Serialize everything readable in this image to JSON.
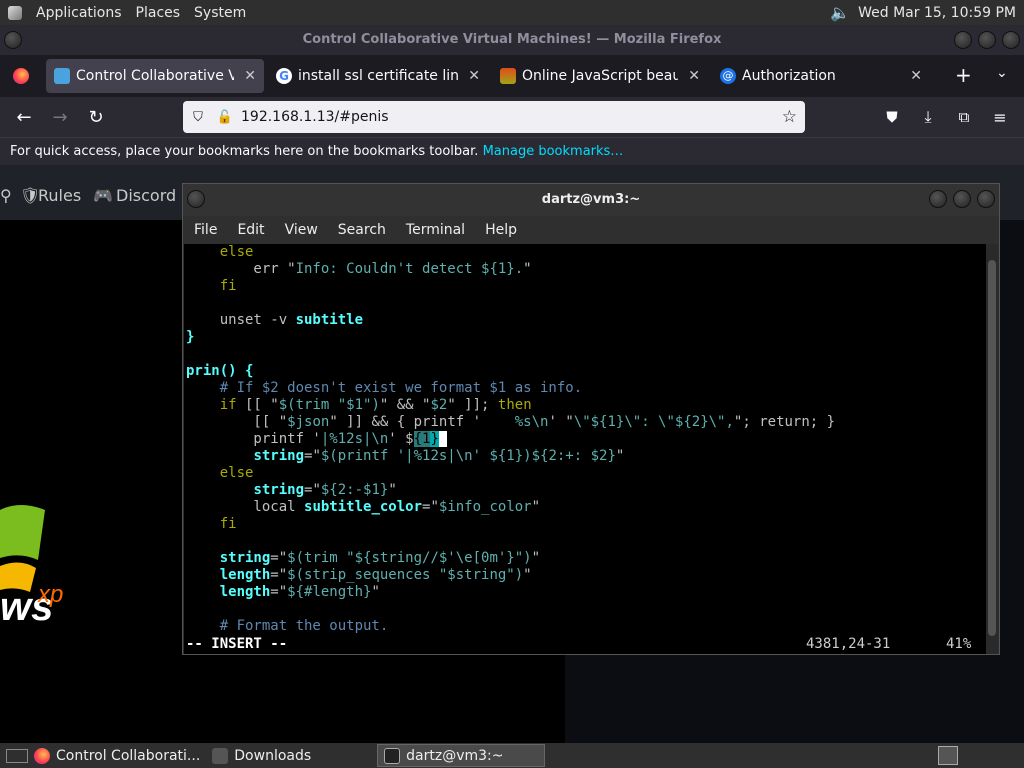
{
  "topbar": {
    "menus": [
      "Applications",
      "Places",
      "System"
    ],
    "datetime": "Wed Mar 15, 10:59 PM"
  },
  "firefox": {
    "title": "Control Collaborative Virtual Machines! — Mozilla Firefox",
    "tabs": [
      {
        "label": "Control Collaborative Virtual",
        "active": true
      },
      {
        "label": "install ssl certificate linux - G"
      },
      {
        "label": "Online JavaScript beautifier"
      },
      {
        "label": "Authorization"
      }
    ],
    "url": "192.168.1.13/#penis",
    "bookmarks_text": "For quick access, place your bookmarks here on the bookmarks toolbar.",
    "bookmarks_link": "Manage bookmarks…"
  },
  "site": {
    "nav_rules": "Rules",
    "nav_discord": "Discord"
  },
  "terminal": {
    "title": "dartz@vm3:~",
    "menu": [
      "File",
      "Edit",
      "View",
      "Search",
      "Terminal",
      "Help"
    ],
    "status_mode": "-- INSERT --",
    "status_pos": "4381,24-31",
    "status_pct": "41%"
  },
  "taskbar": {
    "items": [
      "Control Collaborati...",
      "Downloads",
      "dartz@vm3:~"
    ]
  },
  "colors": {
    "term_bg": "#000000",
    "accent": "#00ddff"
  }
}
